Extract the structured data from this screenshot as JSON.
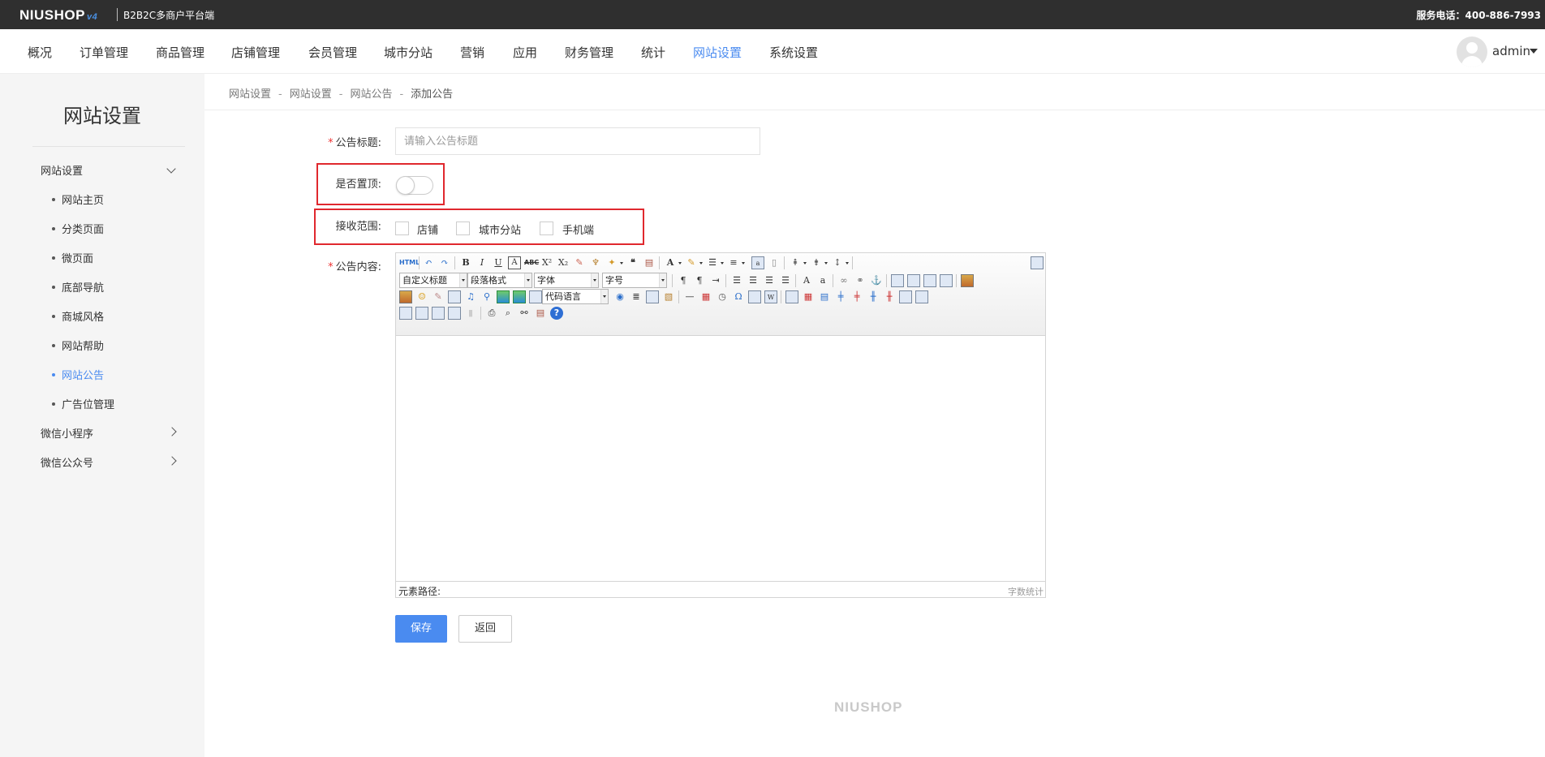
{
  "topbar": {
    "logo": "NIUSHOP",
    "logo_version": "v4",
    "platform": "B2B2C多商户平台端",
    "service": "服务电话：400-886-7993"
  },
  "nav": {
    "items": [
      {
        "label": "概况"
      },
      {
        "label": "订单管理"
      },
      {
        "label": "商品管理"
      },
      {
        "label": "店铺管理"
      },
      {
        "label": "会员管理"
      },
      {
        "label": "城市分站"
      },
      {
        "label": "营销"
      },
      {
        "label": "应用"
      },
      {
        "label": "财务管理"
      },
      {
        "label": "统计"
      },
      {
        "label": "网站设置"
      },
      {
        "label": "系统设置"
      }
    ],
    "active": "网站设置",
    "user": "admin"
  },
  "sidebar": {
    "title": "网站设置",
    "groups": [
      {
        "label": "网站设置",
        "expanded": true
      },
      {
        "label": "微信小程序",
        "expanded": false
      },
      {
        "label": "微信公众号",
        "expanded": false
      }
    ],
    "subitems": [
      {
        "label": "网站主页"
      },
      {
        "label": "分类页面"
      },
      {
        "label": "微页面"
      },
      {
        "label": "底部导航"
      },
      {
        "label": "商城风格"
      },
      {
        "label": "网站帮助"
      },
      {
        "label": "网站公告"
      },
      {
        "label": "广告位管理"
      }
    ],
    "active": "网站公告"
  },
  "breadcrumb": [
    "网站设置",
    "网站设置",
    "网站公告",
    "添加公告"
  ],
  "breadcrumb_separator": "-",
  "form": {
    "required_mark": "*",
    "title_label": "公告标题:",
    "title_placeholder": "请输入公告标题",
    "title_value": "",
    "top_label": "是否置顶:",
    "top_value": false,
    "scope_label": "接收范围:",
    "scope_options": [
      {
        "label": "店铺",
        "checked": false
      },
      {
        "label": "城市分站",
        "checked": false
      },
      {
        "label": "手机端",
        "checked": false
      }
    ],
    "content_label": "公告内容:"
  },
  "editor": {
    "selects": [
      "自定义标题",
      "段落格式",
      "字体",
      "字号",
      "代码语言"
    ],
    "html_button": "HTML",
    "status_path_label": "元素路径:",
    "word_count_label": "字数统计"
  },
  "buttons": {
    "save": "保存",
    "back": "返回"
  },
  "footer": {
    "logo": "NIUSHOP"
  },
  "colors": {
    "accent": "#4a8bf0",
    "topbar_bg": "#2f2f2f",
    "sidebar_bg": "#f5f5f5",
    "highlight_border": "#e0282e",
    "required": "#e33333"
  }
}
